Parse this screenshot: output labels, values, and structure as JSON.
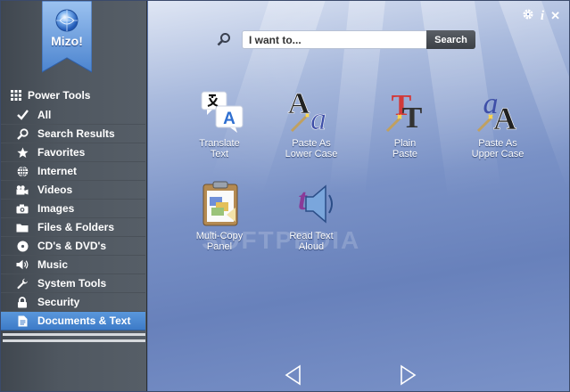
{
  "app": {
    "logo_text": "Mizo!"
  },
  "toolbar": {
    "settings_icon": "gear-icon",
    "info_label": "i",
    "close_label": "✕"
  },
  "sidebar": {
    "header": {
      "label": "Power Tools",
      "icon": "grid-icon"
    },
    "items": [
      {
        "label": "All",
        "icon": "check-icon"
      },
      {
        "label": "Search Results",
        "icon": "search-icon"
      },
      {
        "label": "Favorites",
        "icon": "star-icon"
      },
      {
        "label": "Internet",
        "icon": "globe-icon"
      },
      {
        "label": "Videos",
        "icon": "video-camera-icon"
      },
      {
        "label": "Images",
        "icon": "camera-icon"
      },
      {
        "label": "Files & Folders",
        "icon": "folder-icon"
      },
      {
        "label": "CD's & DVD's",
        "icon": "disc-icon"
      },
      {
        "label": "Music",
        "icon": "speaker-icon"
      },
      {
        "label": "System Tools",
        "icon": "wrench-icon"
      },
      {
        "label": "Security",
        "icon": "lock-icon"
      },
      {
        "label": "Documents & Text",
        "icon": "document-icon",
        "selected": true
      }
    ]
  },
  "search": {
    "placeholder": "I want to...",
    "value": "",
    "button_label": "Search"
  },
  "tools": [
    {
      "label_line1": "Translate",
      "label_line2": "Text",
      "icon": "translate-icon"
    },
    {
      "label_line1": "Paste As",
      "label_line2": "Lower Case",
      "icon": "paste-lower-case-icon"
    },
    {
      "label_line1": "Plain",
      "label_line2": "Paste",
      "icon": "plain-paste-icon"
    },
    {
      "label_line1": "Paste As",
      "label_line2": "Upper Case",
      "icon": "paste-upper-case-icon"
    },
    {
      "label_line1": "Multi-Copy",
      "label_line2": "Panel",
      "icon": "clipboard-icon"
    },
    {
      "label_line1": "Read Text",
      "label_line2": "Aloud",
      "icon": "read-aloud-icon"
    }
  ],
  "watermark": "SOFTPEDIA",
  "colors": {
    "selected_item": "#3d7bc8",
    "sidebar_bg": "#4f5760",
    "main_bg": "#7991c6",
    "search_button": "#3b4046"
  }
}
